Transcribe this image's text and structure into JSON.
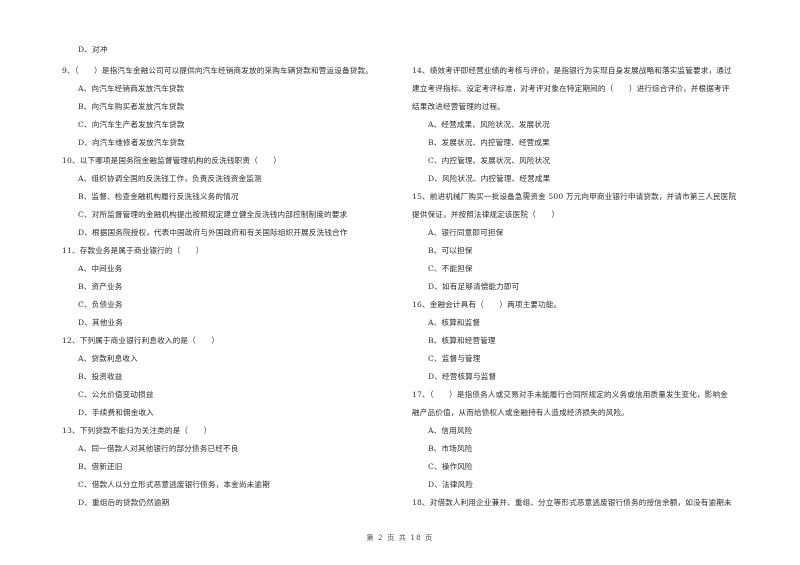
{
  "page": {
    "footer": "第 2 页 共 18 页"
  },
  "left": {
    "lines": [
      {
        "type": "opt",
        "text": "D、对冲"
      },
      {
        "type": "q",
        "text": "9、（　　）是指汽车金融公司可以提供向汽车经销商发放的采购车辆贷款和营运设备贷款。"
      },
      {
        "type": "opt",
        "text": "A、向汽车经销商发放汽车贷款"
      },
      {
        "type": "opt",
        "text": "B、向汽车购买者发放汽车贷款"
      },
      {
        "type": "opt",
        "text": "C、向汽车生产者发放汽车贷款"
      },
      {
        "type": "opt",
        "text": "D、向汽车维修者发放汽车贷款"
      },
      {
        "type": "q",
        "text": "10、以下哪项是国务院金融监督管理机构的反洗钱职责（　　）"
      },
      {
        "type": "opt",
        "text": "A、组织协调全国的反洗钱工作，负责反洗钱资金监测"
      },
      {
        "type": "opt",
        "text": "B、监督、检查金融机构履行反洗钱义务的情况"
      },
      {
        "type": "opt",
        "text": "C、对所监督管理的金融机构提出按照规定建立健全反洗钱内部控制制度的要求"
      },
      {
        "type": "opt",
        "text": "D、根据国务院授权，代表中国政府与外国政府和有关国际组织开展反洗钱合作"
      },
      {
        "type": "q",
        "text": "11、存款业务是属于商业银行的（　　）"
      },
      {
        "type": "opt",
        "text": "A、中间业务"
      },
      {
        "type": "opt",
        "text": "B、资产业务"
      },
      {
        "type": "opt",
        "text": "C、负债业务"
      },
      {
        "type": "opt",
        "text": "D、其他业务"
      },
      {
        "type": "q",
        "text": "12、下列属于商业银行利息收入的是（　　）"
      },
      {
        "type": "opt",
        "text": "A、贷款利息收入"
      },
      {
        "type": "opt",
        "text": "B、投资收益"
      },
      {
        "type": "opt",
        "text": "C、公允价值变动损益"
      },
      {
        "type": "opt",
        "text": "D、手续费和佣金收入"
      },
      {
        "type": "q",
        "text": "13、下列贷款不能归为关注类的是（　　）"
      },
      {
        "type": "opt",
        "text": "A、同一借款人对其他银行的部分债务已经不良"
      },
      {
        "type": "opt",
        "text": "B、借新还旧"
      },
      {
        "type": "opt",
        "text": "C、借款人以分立形式恶意逃废银行债务，本金尚未逾期"
      },
      {
        "type": "opt",
        "text": "D、重组后的贷款仍然逾期"
      }
    ]
  },
  "right": {
    "lines": [
      {
        "type": "q",
        "text": "14、绩效考评即经营业绩的考核与评价，是指银行为实现自身发展战略和落实监管要求，通过"
      },
      {
        "type": "q",
        "text": "建立考评指标、设定考评标准，对考评对象在特定期间的（　　）进行综合评价，并根据考评"
      },
      {
        "type": "q",
        "text": "结果改进经营管理的过程。"
      },
      {
        "type": "opt",
        "text": "A、经营成果、风险状况、发展状况"
      },
      {
        "type": "opt",
        "text": "B、发展状况、内控管理、经营成果"
      },
      {
        "type": "opt",
        "text": "C、内控管理、发展状况、风险状况"
      },
      {
        "type": "opt",
        "text": "D、风险状况、内控管理、经营成果"
      },
      {
        "type": "q",
        "text": "15、前进机械厂购买一批设备急需资金 500 万元向甲商业银行申请贷款，并请市第三人民医院"
      },
      {
        "type": "q",
        "text": "提供保证，并按照法律规定该医院（　　）"
      },
      {
        "type": "opt",
        "text": "A、银行同意即可担保"
      },
      {
        "type": "opt",
        "text": "B、可以担保"
      },
      {
        "type": "opt",
        "text": "C、不能担保"
      },
      {
        "type": "opt",
        "text": "D、如有足够清偿能力即可"
      },
      {
        "type": "q",
        "text": "16、金融会计具有（　　）两项主要功能。"
      },
      {
        "type": "opt",
        "text": "A、核算和监督"
      },
      {
        "type": "opt",
        "text": "B、核算和经营管理"
      },
      {
        "type": "opt",
        "text": "C、监督与管理"
      },
      {
        "type": "opt",
        "text": "D、经营核算与监督"
      },
      {
        "type": "q",
        "text": "17、（　　）是指债务人或交易对手未能履行合同所规定的义务或信用质量发生变化，影响金"
      },
      {
        "type": "q",
        "text": "融产品价值，从而给债权人或金融持有人造成经济损失的风险。"
      },
      {
        "type": "opt",
        "text": "A、信用风险"
      },
      {
        "type": "opt",
        "text": "B、市场风险"
      },
      {
        "type": "opt",
        "text": "C、操作风险"
      },
      {
        "type": "opt",
        "text": "D、法律风险"
      },
      {
        "type": "q",
        "text": "18、对借款人利用企业兼并、重组、分立等形式恶意逃废银行债务的授信余额，如没有逾期未"
      }
    ]
  }
}
